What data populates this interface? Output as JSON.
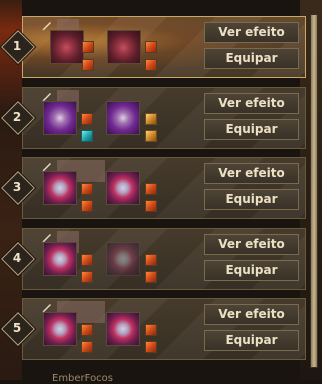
{
  "buttons": {
    "view_effect": "Ver efeito",
    "equip": "Equipar"
  },
  "presets": [
    {
      "number": "1",
      "active": true,
      "gems": [
        "red",
        "red"
      ],
      "mini": [
        [
          "red",
          "red"
        ],
        [
          "red",
          "red"
        ]
      ]
    },
    {
      "number": "2",
      "active": false,
      "gems": [
        "mech",
        "mech"
      ],
      "mini": [
        [
          "red",
          "teal"
        ],
        [
          "gold",
          "gold"
        ]
      ]
    },
    {
      "number": "3",
      "active": false,
      "gems": [
        "orb",
        "orb"
      ],
      "mini": [
        [
          "red",
          "red"
        ],
        [
          "red",
          "red"
        ]
      ]
    },
    {
      "number": "4",
      "active": false,
      "gems": [
        "orb",
        "orb-dim"
      ],
      "mini": [
        [
          "red",
          "red"
        ],
        [
          "red",
          "red"
        ]
      ]
    },
    {
      "number": "5",
      "active": false,
      "gems": [
        "orb",
        "orb"
      ],
      "mini": [
        [
          "red",
          "red"
        ],
        [
          "red",
          "red"
        ]
      ]
    }
  ],
  "footer": {
    "text": "EmberFocos"
  },
  "colors": {
    "active_border": "#c9a866",
    "button_text": "#ece0c4",
    "panel_bg": "#3a3226"
  }
}
